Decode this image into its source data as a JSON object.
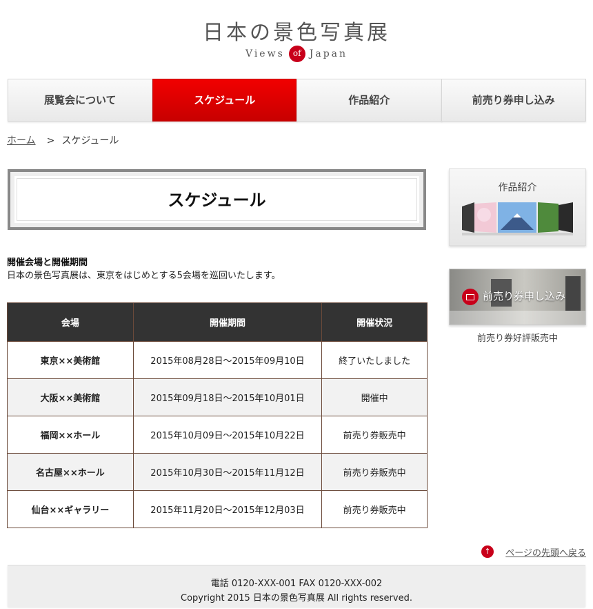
{
  "header": {
    "title": "日本の景色写真展",
    "subtitle_left": "Views",
    "subtitle_of": "of",
    "subtitle_right": "Japan"
  },
  "nav": {
    "items": [
      {
        "label": "展覧会について",
        "active": false
      },
      {
        "label": "スケジュール",
        "active": true
      },
      {
        "label": "作品紹介",
        "active": false
      },
      {
        "label": "前売り券申し込み",
        "active": false
      }
    ]
  },
  "breadcrumb": {
    "home": "ホーム",
    "separator": ">",
    "current": "スケジュール"
  },
  "page_title": "スケジュール",
  "intro": {
    "heading": "開催会場と開催期間",
    "text": "日本の景色写真展は、東京をはじめとする5会場を巡回いたします。"
  },
  "schedule": {
    "headers": [
      "会場",
      "開催期間",
      "開催状況"
    ],
    "rows": [
      {
        "venue": "東京××美術館",
        "period": "2015年08月28日～2015年09月10日",
        "status": "終了いたしました"
      },
      {
        "venue": "大阪××美術館",
        "period": "2015年09月18日～2015年10月01日",
        "status": "開催中"
      },
      {
        "venue": "福岡××ホール",
        "period": "2015年10月09日～2015年10月22日",
        "status": "前売り券販売中"
      },
      {
        "venue": "名古屋××ホール",
        "period": "2015年10月30日～2015年11月12日",
        "status": "前売り券販売中"
      },
      {
        "venue": "仙台××ギャラリー",
        "period": "2015年11月20日～2015年12月03日",
        "status": "前売り券販売中"
      }
    ]
  },
  "sidebar": {
    "works_title": "作品紹介",
    "ticket_label": "前売り券申し込み",
    "ticket_note": "前売り券好評販売中"
  },
  "pagetop": "ページの先頭へ戻る",
  "footer": {
    "contact": "電話 0120-XXX-001 FAX 0120-XXX-002",
    "copyright": "Copyright 2015 日本の景色写真展 All rights reserved."
  },
  "colors": {
    "accent": "#c8001a",
    "nav_active": "#e60000",
    "table_header": "#333333"
  },
  "icons": {
    "pagetop": "arrow-up-circle-icon",
    "ticket": "ticket-icon"
  }
}
